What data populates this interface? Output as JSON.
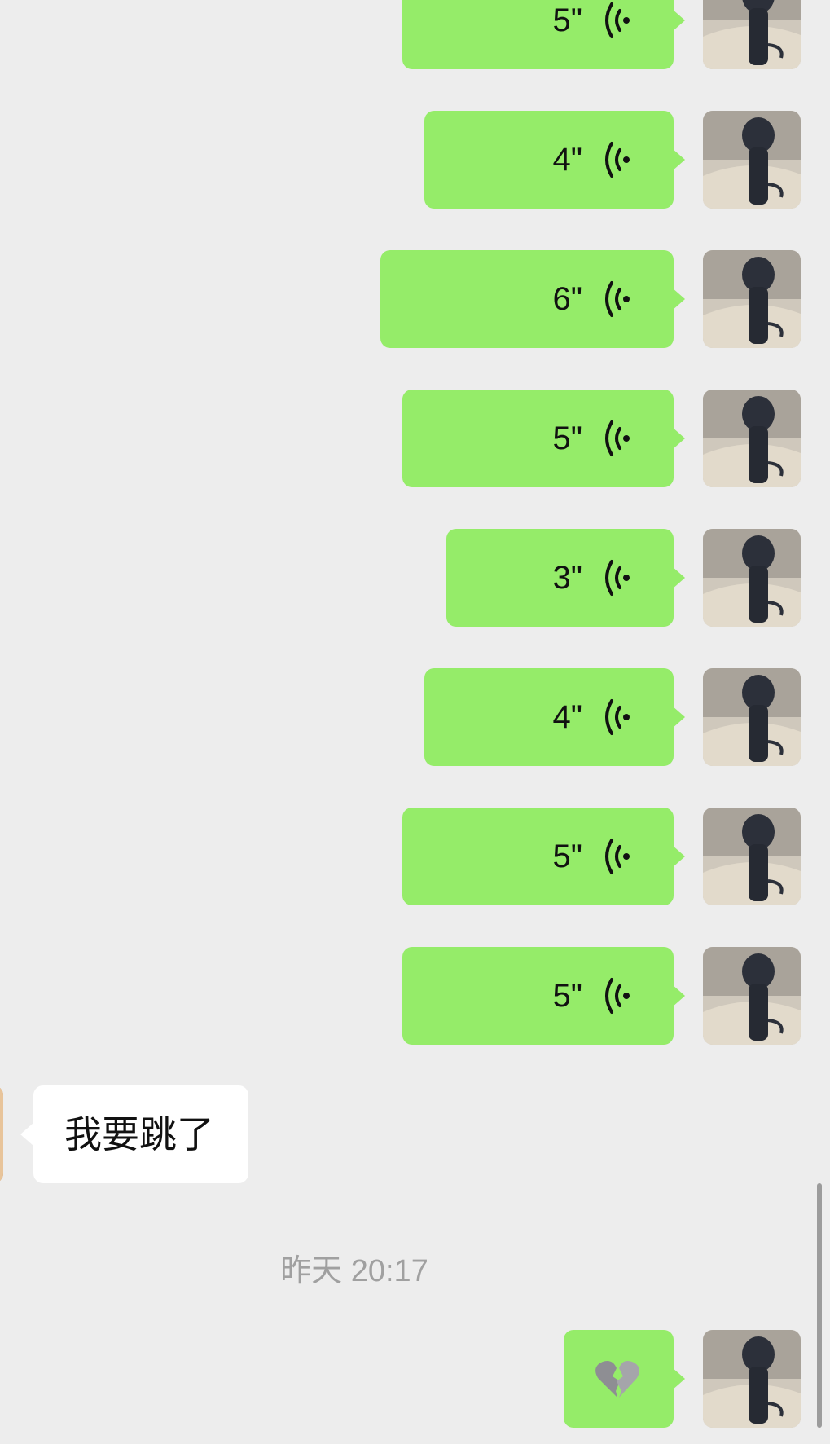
{
  "messages": [
    {
      "sender": "me",
      "type": "voice",
      "duration": "5\""
    },
    {
      "sender": "me",
      "type": "voice",
      "duration": "4\""
    },
    {
      "sender": "me",
      "type": "voice",
      "duration": "6\""
    },
    {
      "sender": "me",
      "type": "voice",
      "duration": "5\""
    },
    {
      "sender": "me",
      "type": "voice",
      "duration": "3\""
    },
    {
      "sender": "me",
      "type": "voice",
      "duration": "4\""
    },
    {
      "sender": "me",
      "type": "voice",
      "duration": "5\""
    },
    {
      "sender": "me",
      "type": "voice",
      "duration": "5\""
    },
    {
      "sender": "other",
      "type": "text",
      "text": "我要跳了"
    },
    {
      "sender": "me",
      "type": "emoji",
      "emoji": "broken-heart"
    }
  ],
  "timestamp": "昨天 20:17",
  "colors": {
    "background": "#ededed",
    "my_bubble": "#95ec69",
    "other_bubble": "#ffffff",
    "timestamp_text": "#a0a0a0"
  },
  "icons": {
    "voice": "voice-wave-icon",
    "avatar": "user-avatar",
    "emoji": "broken-heart-icon"
  }
}
